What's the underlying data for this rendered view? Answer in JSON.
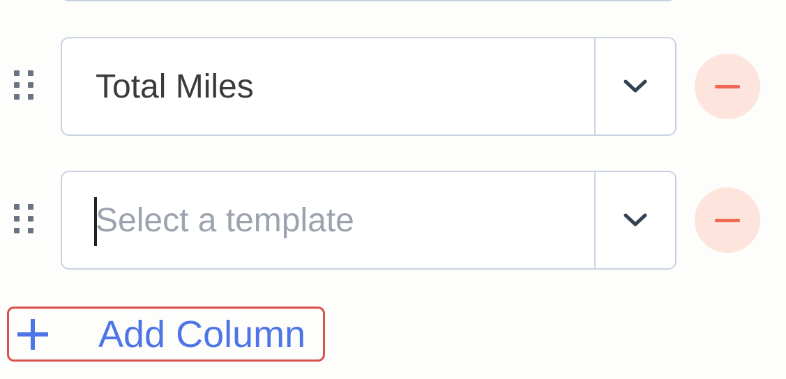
{
  "columns": [
    {
      "value": "Total Miles",
      "placeholder": ""
    },
    {
      "value": "",
      "placeholder": "Select a template"
    }
  ],
  "icons": {
    "drag": "drag-handle-icon",
    "toggle": "chevron-down-icon",
    "remove": "minus-circle-icon",
    "add": "plus-icon"
  },
  "actions": {
    "add_column_label": "Add Column"
  },
  "colors": {
    "accent": "#4d75e8",
    "remove": "#ef6a55",
    "highlight_border": "#d9514a"
  }
}
